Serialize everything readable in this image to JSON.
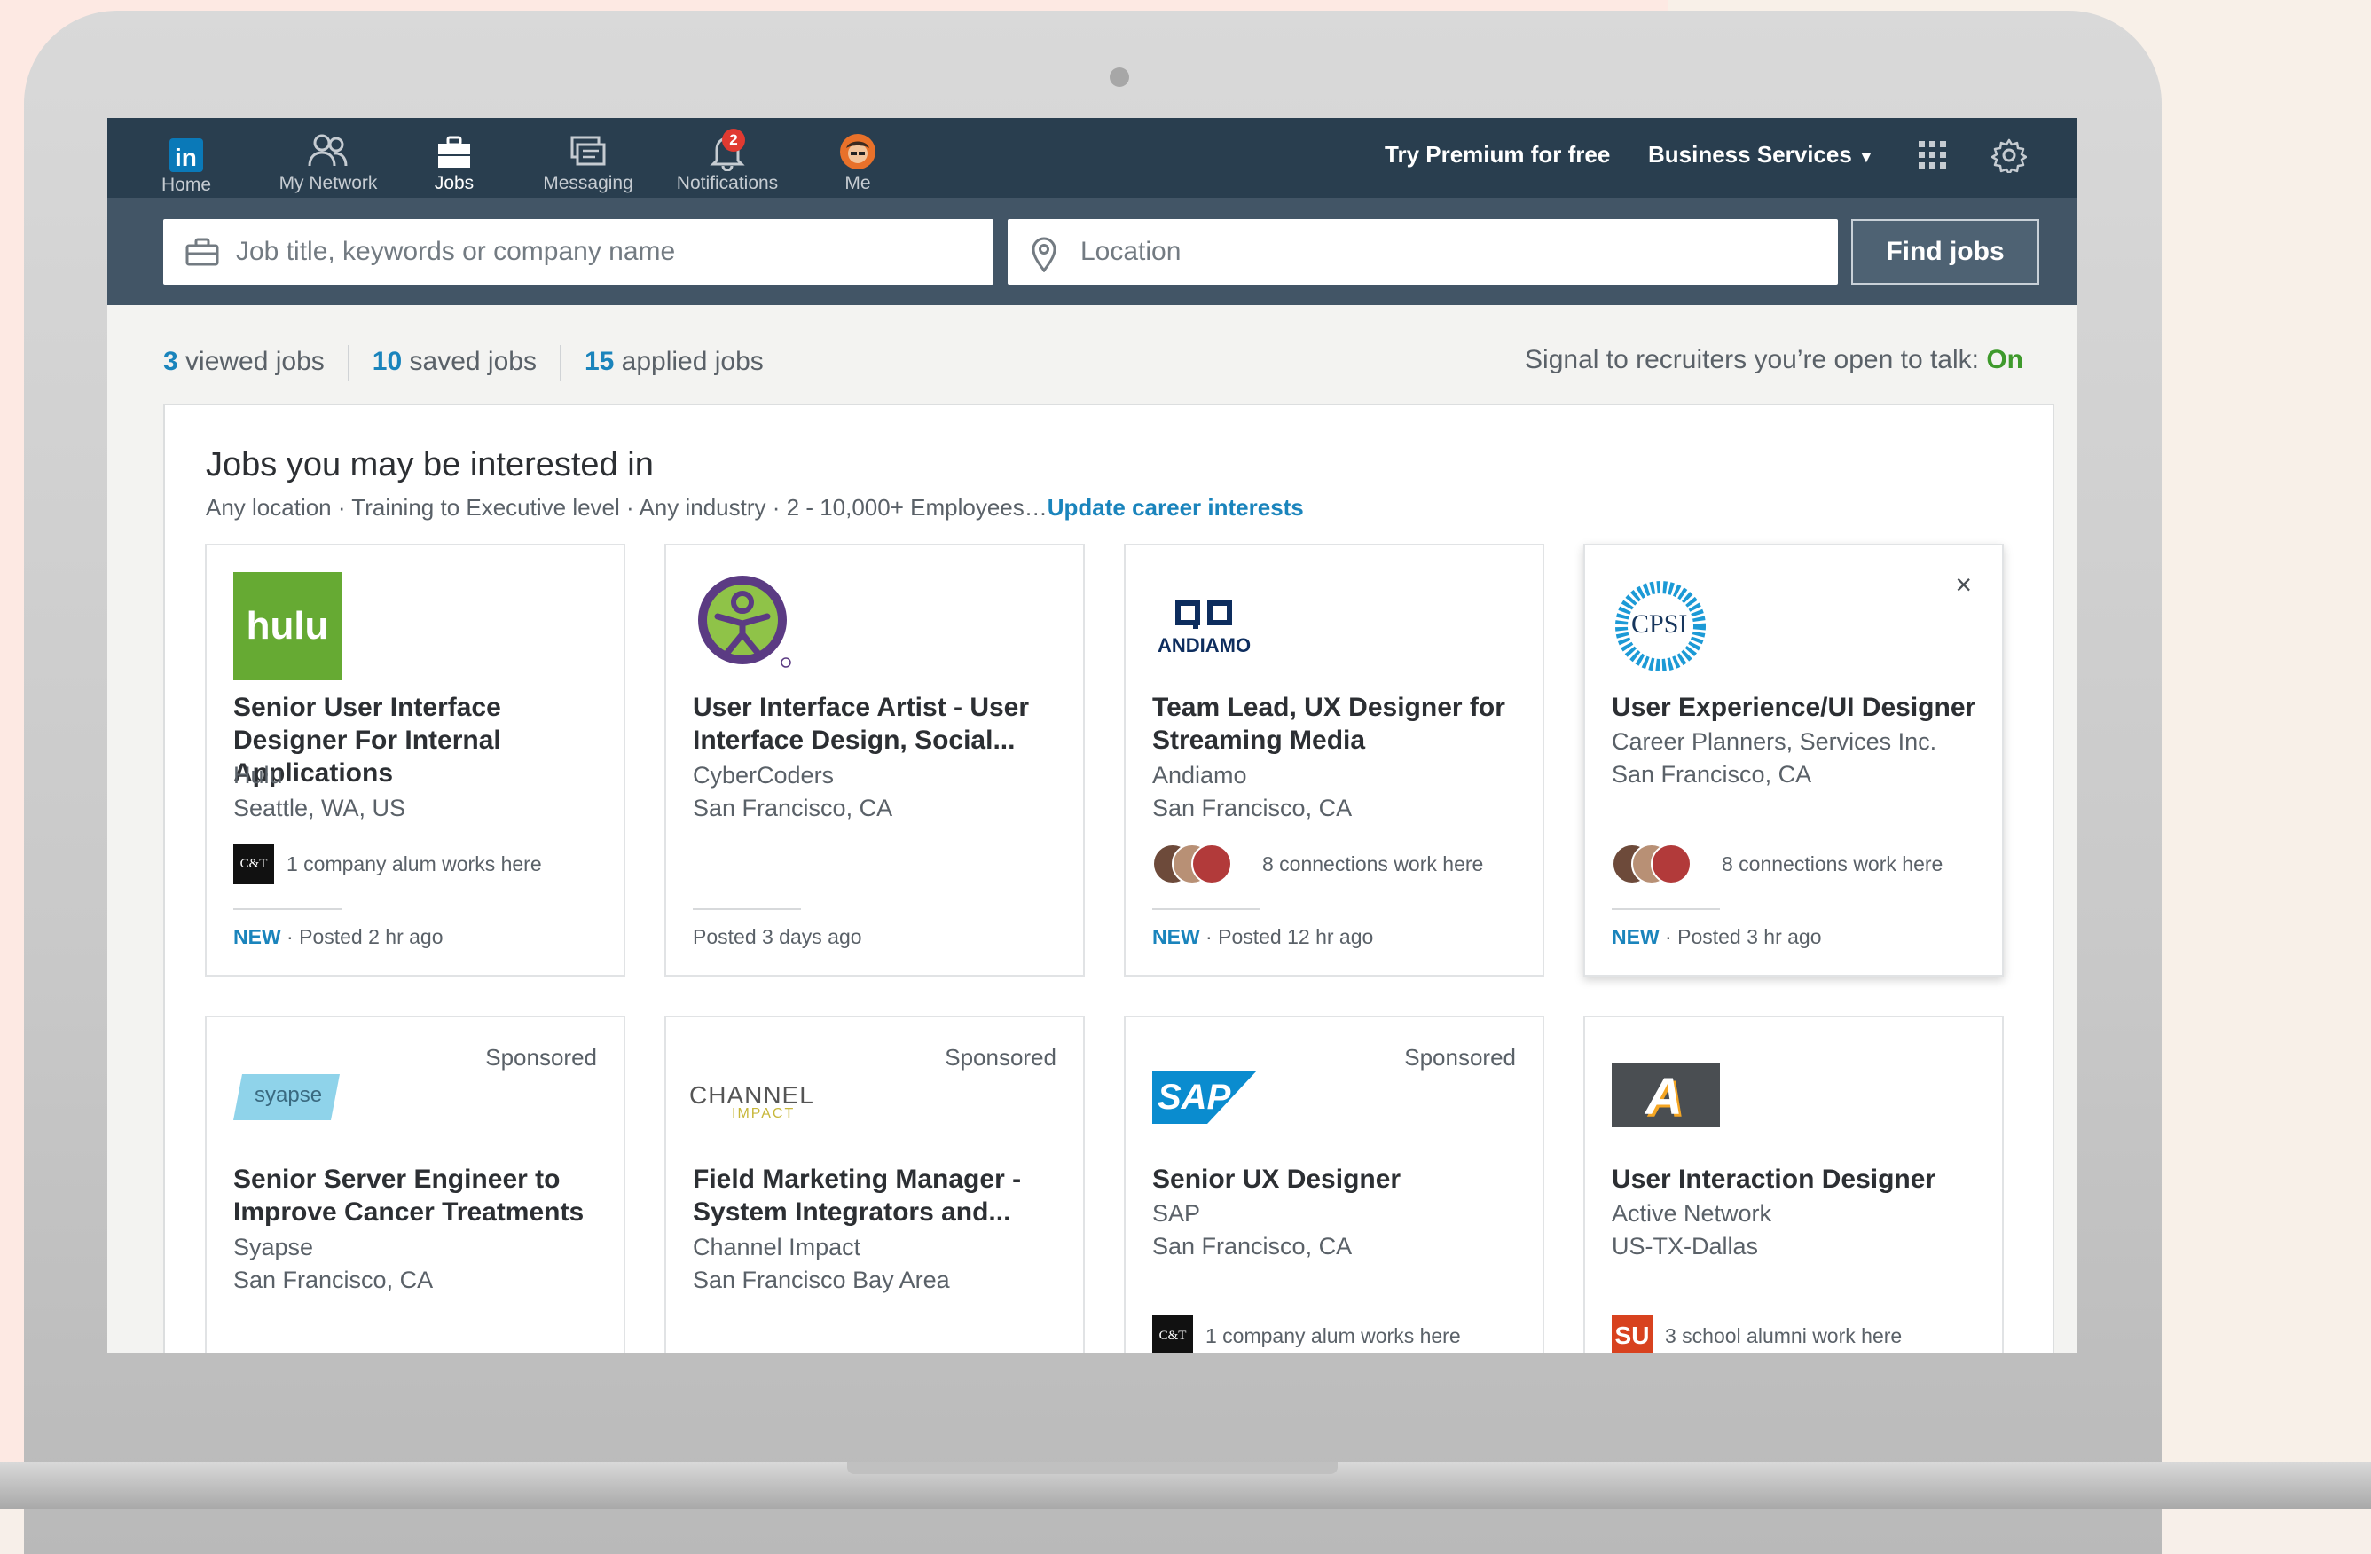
{
  "nav": {
    "items": [
      {
        "label": "Home",
        "icon": "linkedin-logo"
      },
      {
        "label": "My Network",
        "icon": "network-icon"
      },
      {
        "label": "Jobs",
        "icon": "briefcase-icon"
      },
      {
        "label": "Messaging",
        "icon": "messaging-icon"
      },
      {
        "label": "Notifications",
        "icon": "bell-icon",
        "badge": "2"
      },
      {
        "label": "Me",
        "icon": "avatar"
      }
    ],
    "premium": "Try Premium for free",
    "business": "Business Services"
  },
  "search": {
    "keywords_placeholder": "Job title, keywords or company name",
    "location_placeholder": "Location",
    "find_label": "Find jobs"
  },
  "stats": {
    "viewed_count": "3",
    "viewed_label": "viewed jobs",
    "saved_count": "10",
    "saved_label": "saved jobs",
    "applied_count": "15",
    "applied_label": "applied jobs",
    "signal_label": "Signal to recruiters you’re open to talk:",
    "signal_value": "On"
  },
  "panel": {
    "title": "Jobs you may be interested in",
    "subtitle": "Any location · Training to Executive level · Any industry · 2 - 10,000+ Employees…",
    "update_link": "Update career interests"
  },
  "jobs": [
    {
      "title": "Senior User Interface Designer For Internal Applications",
      "company": "Hulu",
      "location": "Seattle, WA, US",
      "social": "1 company alum works here",
      "new": "NEW",
      "posted": " · Posted 2 hr ago",
      "logo_text": "hulu"
    },
    {
      "title": "User Interface Artist - User Interface Design, Social...",
      "company": "CyberCoders",
      "location": "San Francisco, CA",
      "social": "",
      "new": "",
      "posted": "Posted 3 days ago"
    },
    {
      "title": "Team Lead, UX Designer for Streaming Media",
      "company": "Andiamo",
      "location": "San Francisco, CA",
      "social": "8 connections work here",
      "new": "NEW",
      "posted": " · Posted 12 hr ago",
      "logo_text": "ANDIAMO"
    },
    {
      "title": "User Experience/UI Designer",
      "company": "Career Planners, Services Inc.",
      "location": "San Francisco, CA",
      "social": "8 connections work here",
      "new": "NEW",
      "posted": " · Posted 3 hr ago",
      "logo_text": "CPSI",
      "close": "×"
    },
    {
      "title": "Senior Server Engineer to Improve Cancer Treatments",
      "company": "Syapse",
      "location": "San Francisco, CA",
      "sponsored": "Sponsored",
      "logo_text": "syapse"
    },
    {
      "title": "Field Marketing Manager - System Integrators and...",
      "company": "Channel Impact",
      "location": "San Francisco Bay Area",
      "sponsored": "Sponsored",
      "logo_text": "CHANNEL",
      "logo_sub": "IMPACT"
    },
    {
      "title": "Senior UX Designer",
      "company": "SAP",
      "location": "San Francisco, CA",
      "social": "1 company alum works here",
      "sponsored": "Sponsored",
      "logo_text": "SAP"
    },
    {
      "title": "User Interaction Designer",
      "company": "Active Network",
      "location": "US-TX-Dallas",
      "social": "3 school alumni work here",
      "logo_text": "A"
    }
  ],
  "badges": {
    "ct": "C&T",
    "su": "SU"
  },
  "colors": {
    "nav_bg": "#293e4f",
    "search_bg": "#425566",
    "link": "#1a84bc",
    "on": "#3e9a2c"
  }
}
